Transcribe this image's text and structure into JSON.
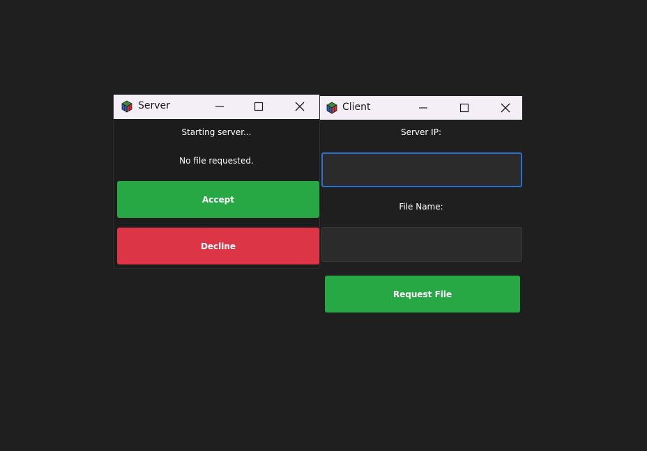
{
  "server": {
    "title": "Server",
    "status": "Starting server...",
    "request_status": "No file requested.",
    "accept_label": "Accept",
    "decline_label": "Decline",
    "colors": {
      "accept": "#28a745",
      "decline": "#dc3545"
    }
  },
  "client": {
    "title": "Client",
    "server_ip_label": "Server IP:",
    "server_ip_value": "",
    "file_name_label": "File Name:",
    "file_name_value": "",
    "request_label": "Request File",
    "colors": {
      "request": "#28a745",
      "focus": "#2a6fd6"
    }
  },
  "icons": {
    "app": "colored-cube-icon",
    "minimize": "minimize-icon",
    "maximize": "maximize-icon",
    "close": "close-icon"
  }
}
